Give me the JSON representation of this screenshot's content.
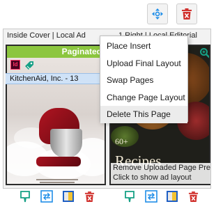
{
  "toolbar": {
    "move_icon": "move-arrows-icon",
    "delete_icon": "trash-icon",
    "accent_blue": "#1f8ee8",
    "accent_red": "#d0312d"
  },
  "left_page": {
    "label": "Inside Cover | Local Ad",
    "status": "Paginated",
    "status_color": "#8cc63f",
    "ad_name": "KitchenAid, Inc. - 13"
  },
  "right_page": {
    "label": "1 Right | Local Editorial",
    "cover_line1": "60+",
    "cover_line2": "Recipes",
    "overlay_line1": "Remove Uploaded Page Preview",
    "overlay_line2": "Click to show ad layout"
  },
  "context_menu": {
    "items": [
      {
        "label": "Place Insert"
      },
      {
        "label": "Upload Final Layout"
      },
      {
        "label": "Swap Pages"
      },
      {
        "label": "Change Page Layout"
      },
      {
        "label": "Delete This Page"
      }
    ],
    "hover_index": 4
  },
  "bottom_icons": [
    "comment-icon",
    "swap-icon",
    "layout-color-icon",
    "trash-icon"
  ],
  "colors": {
    "teal": "#16a085",
    "blue": "#1f8ee8",
    "red": "#d0312d",
    "selection": "#cfe2f7"
  }
}
